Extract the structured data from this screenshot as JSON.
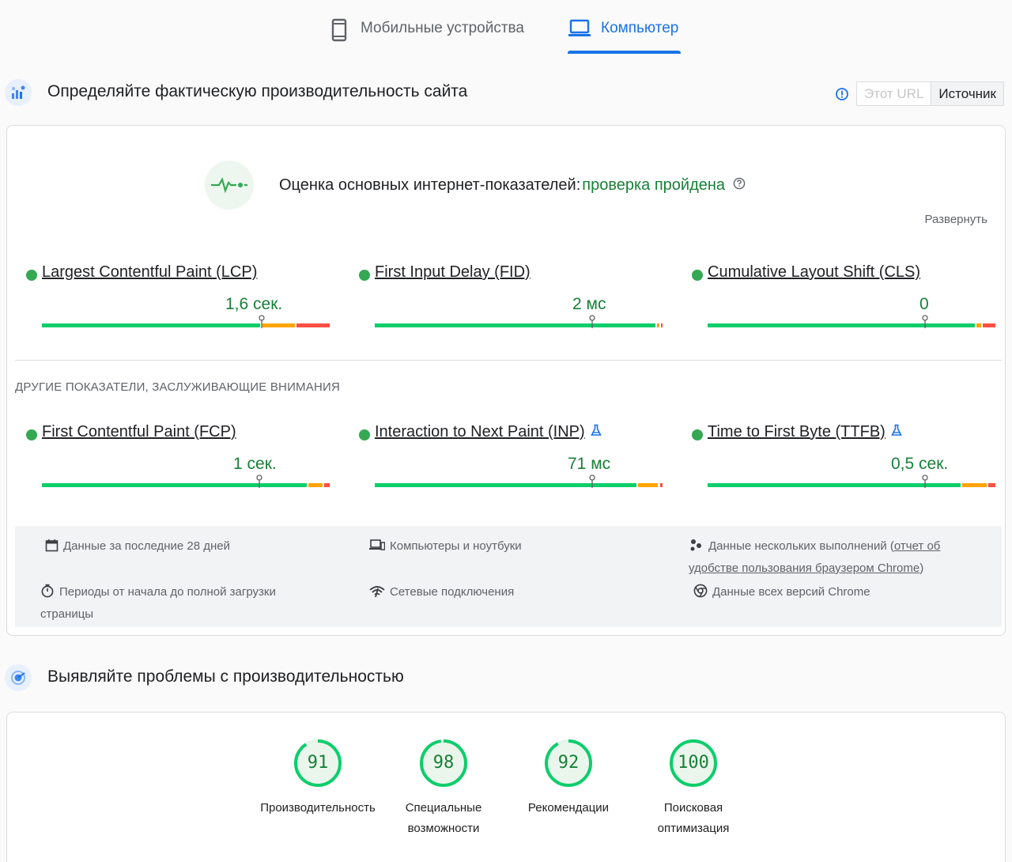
{
  "tabs": {
    "mobile_label": "Мобильные устройства",
    "desktop_label": "Компьютер"
  },
  "field": {
    "title": "Определяйте фактическую производительность сайта",
    "toggle": {
      "this_url": "Этот URL",
      "origin": "Источник"
    },
    "assessment": {
      "label": "Оценка основных интернет-показателей:",
      "result": "проверка пройдена"
    },
    "expand_label": "Развернуть",
    "other_title": "ДРУГИЕ ПОКАЗАТЕЛИ, ЗАСЛУЖИВАЮЩИЕ ВНИМАНИЯ",
    "core_metrics": [
      {
        "name": "Largest Contentful Paint (LCP)",
        "value": "1,6 сек.",
        "good_fraction": 0.76,
        "ni_fraction": 0.12,
        "poor_fraction": 0.12,
        "marker_fraction": 0.76
      },
      {
        "name": "First Input Delay (FID)",
        "value": "2 мс",
        "good_fraction": 0.975,
        "ni_fraction": 0.015,
        "poor_fraction": 0.01,
        "marker_fraction": 0.75
      },
      {
        "name": "Cumulative Layout Shift (CLS)",
        "value": "0",
        "good_fraction": 0.93,
        "ni_fraction": 0.02,
        "poor_fraction": 0.05,
        "marker_fraction": 0.75
      }
    ],
    "other_metrics": [
      {
        "name": "First Contentful Paint (FCP)",
        "value": "1 сек.",
        "good_fraction": 0.92,
        "ni_fraction": 0.055,
        "poor_fraction": 0.025,
        "marker_fraction": 0.75
      },
      {
        "name": "Interaction to Next Paint (INP)",
        "value": "71 мс",
        "good_fraction": 0.91,
        "ni_fraction": 0.075,
        "poor_fraction": 0.015,
        "marker_fraction": 0.75
      },
      {
        "name": "Time to First Byte (TTFB)",
        "value": "0,5 сек.",
        "good_fraction": 0.88,
        "ni_fraction": 0.09,
        "poor_fraction": 0.03,
        "marker_fraction": 0.75
      }
    ],
    "info": {
      "period": "Данные за последние 28 дней",
      "devices": "Компьютеры и ноутбуки",
      "samples_prefix": "Данные нескольких выполнений (",
      "samples_link_1": "отчет об",
      "samples_link_2": "удобстве пользования браузером Chrome",
      "samples_suffix": ")",
      "duration_1": "Периоды от начала до полной загрузки",
      "duration_2": "страницы",
      "network": "Сетевые подключения",
      "versions": "Данные всех версий Chrome"
    }
  },
  "lab": {
    "title": "Выявляйте проблемы с производительностью",
    "scores": [
      {
        "value": "91",
        "label_1": "Производительность",
        "label_2": ""
      },
      {
        "value": "98",
        "label_1": "Специальные",
        "label_2": "возможности"
      },
      {
        "value": "92",
        "label_1": "Рекомендации",
        "label_2": ""
      },
      {
        "value": "100",
        "label_1": "Поисковая",
        "label_2": "оптимизация"
      }
    ]
  },
  "colors": {
    "accent": "#1a73e8",
    "good": "#0cce6b",
    "good_text": "#188038",
    "average": "#ffa400",
    "poor": "#ff4e42"
  }
}
